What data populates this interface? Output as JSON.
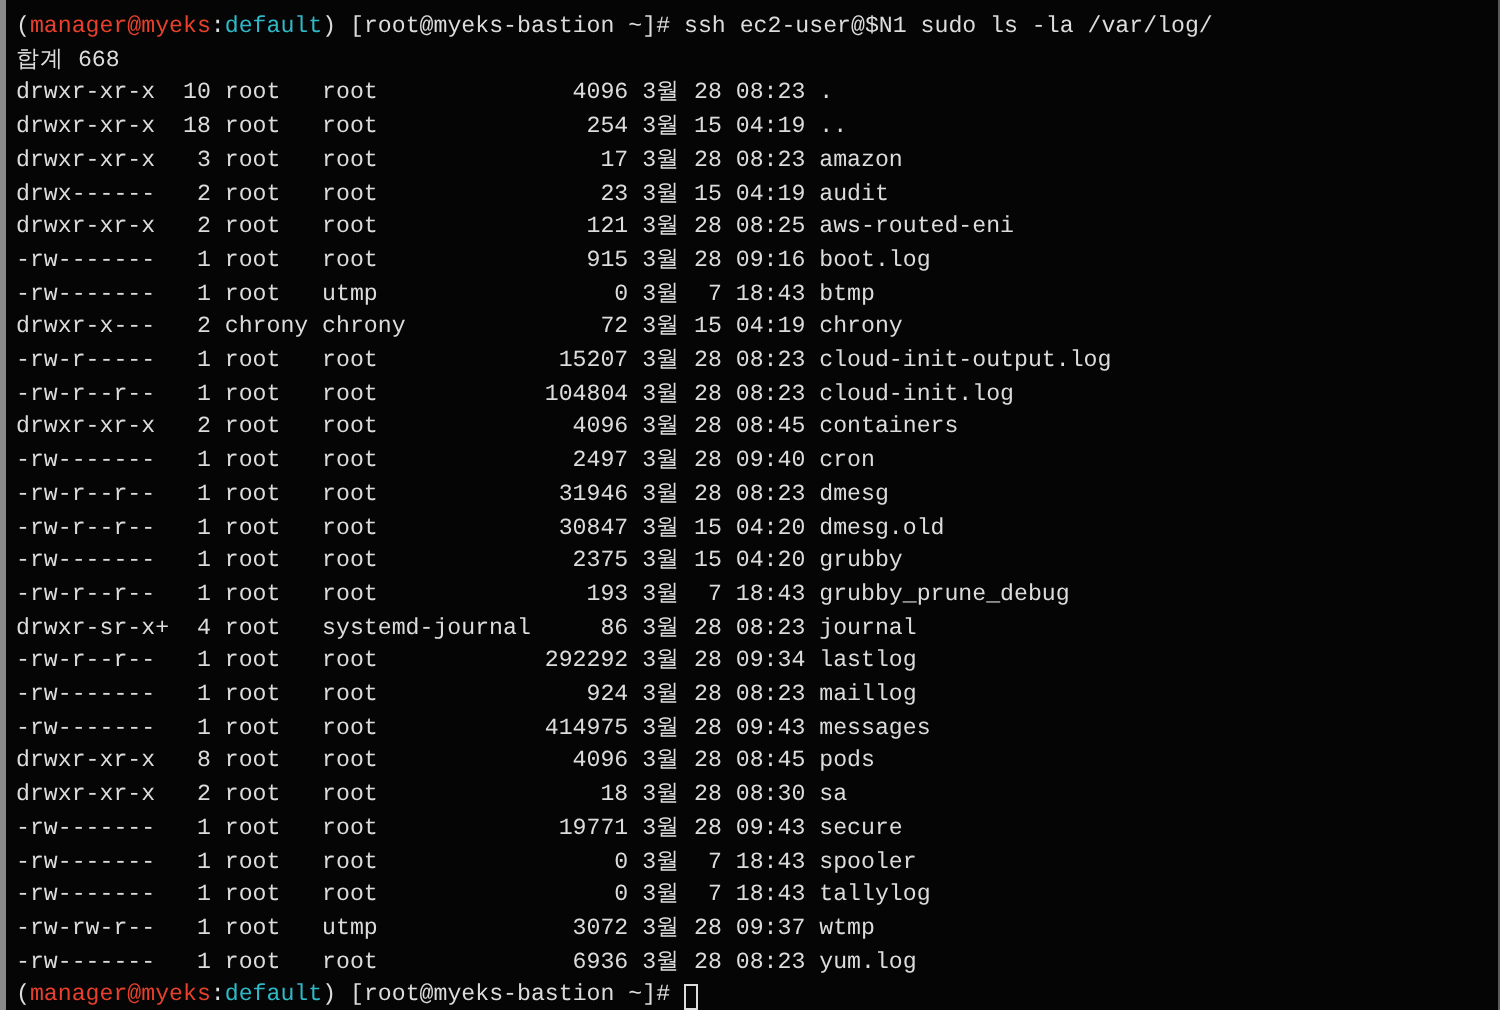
{
  "terminal": {
    "prompt": {
      "segments": [
        {
          "kind": "plain",
          "text": "("
        },
        {
          "kind": "user",
          "text": "manager@myeks"
        },
        {
          "kind": "plain",
          "text": ":"
        },
        {
          "kind": "context",
          "text": "default"
        },
        {
          "kind": "plain",
          "text": ") [root@myeks-bastion ~]# "
        }
      ],
      "command": "ssh ec2-user@$N1 sudo ls -la /var/log/"
    },
    "total": "합계 668",
    "rows": [
      {
        "perms": "drwxr-xr-x",
        "links": "10",
        "owner": "root",
        "group": "root",
        "size": "4096",
        "month": "3월",
        "day": "28",
        "time": "08:23",
        "name": "."
      },
      {
        "perms": "drwxr-xr-x",
        "links": "18",
        "owner": "root",
        "group": "root",
        "size": "254",
        "month": "3월",
        "day": "15",
        "time": "04:19",
        "name": ".."
      },
      {
        "perms": "drwxr-xr-x",
        "links": "3",
        "owner": "root",
        "group": "root",
        "size": "17",
        "month": "3월",
        "day": "28",
        "time": "08:23",
        "name": "amazon"
      },
      {
        "perms": "drwx------",
        "links": "2",
        "owner": "root",
        "group": "root",
        "size": "23",
        "month": "3월",
        "day": "15",
        "time": "04:19",
        "name": "audit"
      },
      {
        "perms": "drwxr-xr-x",
        "links": "2",
        "owner": "root",
        "group": "root",
        "size": "121",
        "month": "3월",
        "day": "28",
        "time": "08:25",
        "name": "aws-routed-eni"
      },
      {
        "perms": "-rw-------",
        "links": "1",
        "owner": "root",
        "group": "root",
        "size": "915",
        "month": "3월",
        "day": "28",
        "time": "09:16",
        "name": "boot.log"
      },
      {
        "perms": "-rw-------",
        "links": "1",
        "owner": "root",
        "group": "utmp",
        "size": "0",
        "month": "3월",
        "day": "7",
        "time": "18:43",
        "name": "btmp"
      },
      {
        "perms": "drwxr-x---",
        "links": "2",
        "owner": "chrony",
        "group": "chrony",
        "size": "72",
        "month": "3월",
        "day": "15",
        "time": "04:19",
        "name": "chrony"
      },
      {
        "perms": "-rw-r-----",
        "links": "1",
        "owner": "root",
        "group": "root",
        "size": "15207",
        "month": "3월",
        "day": "28",
        "time": "08:23",
        "name": "cloud-init-output.log"
      },
      {
        "perms": "-rw-r--r--",
        "links": "1",
        "owner": "root",
        "group": "root",
        "size": "104804",
        "month": "3월",
        "day": "28",
        "time": "08:23",
        "name": "cloud-init.log"
      },
      {
        "perms": "drwxr-xr-x",
        "links": "2",
        "owner": "root",
        "group": "root",
        "size": "4096",
        "month": "3월",
        "day": "28",
        "time": "08:45",
        "name": "containers"
      },
      {
        "perms": "-rw-------",
        "links": "1",
        "owner": "root",
        "group": "root",
        "size": "2497",
        "month": "3월",
        "day": "28",
        "time": "09:40",
        "name": "cron"
      },
      {
        "perms": "-rw-r--r--",
        "links": "1",
        "owner": "root",
        "group": "root",
        "size": "31946",
        "month": "3월",
        "day": "28",
        "time": "08:23",
        "name": "dmesg"
      },
      {
        "perms": "-rw-r--r--",
        "links": "1",
        "owner": "root",
        "group": "root",
        "size": "30847",
        "month": "3월",
        "day": "15",
        "time": "04:20",
        "name": "dmesg.old"
      },
      {
        "perms": "-rw-------",
        "links": "1",
        "owner": "root",
        "group": "root",
        "size": "2375",
        "month": "3월",
        "day": "15",
        "time": "04:20",
        "name": "grubby"
      },
      {
        "perms": "-rw-r--r--",
        "links": "1",
        "owner": "root",
        "group": "root",
        "size": "193",
        "month": "3월",
        "day": "7",
        "time": "18:43",
        "name": "grubby_prune_debug"
      },
      {
        "perms": "drwxr-sr-x+",
        "links": "4",
        "owner": "root",
        "group": "systemd-journal",
        "size": "86",
        "month": "3월",
        "day": "28",
        "time": "08:23",
        "name": "journal"
      },
      {
        "perms": "-rw-r--r--",
        "links": "1",
        "owner": "root",
        "group": "root",
        "size": "292292",
        "month": "3월",
        "day": "28",
        "time": "09:34",
        "name": "lastlog"
      },
      {
        "perms": "-rw-------",
        "links": "1",
        "owner": "root",
        "group": "root",
        "size": "924",
        "month": "3월",
        "day": "28",
        "time": "08:23",
        "name": "maillog"
      },
      {
        "perms": "-rw-------",
        "links": "1",
        "owner": "root",
        "group": "root",
        "size": "414975",
        "month": "3월",
        "day": "28",
        "time": "09:43",
        "name": "messages"
      },
      {
        "perms": "drwxr-xr-x",
        "links": "8",
        "owner": "root",
        "group": "root",
        "size": "4096",
        "month": "3월",
        "day": "28",
        "time": "08:45",
        "name": "pods"
      },
      {
        "perms": "drwxr-xr-x",
        "links": "2",
        "owner": "root",
        "group": "root",
        "size": "18",
        "month": "3월",
        "day": "28",
        "time": "08:30",
        "name": "sa"
      },
      {
        "perms": "-rw-------",
        "links": "1",
        "owner": "root",
        "group": "root",
        "size": "19771",
        "month": "3월",
        "day": "28",
        "time": "09:43",
        "name": "secure"
      },
      {
        "perms": "-rw-------",
        "links": "1",
        "owner": "root",
        "group": "root",
        "size": "0",
        "month": "3월",
        "day": "7",
        "time": "18:43",
        "name": "spooler"
      },
      {
        "perms": "-rw-------",
        "links": "1",
        "owner": "root",
        "group": "root",
        "size": "0",
        "month": "3월",
        "day": "7",
        "time": "18:43",
        "name": "tallylog"
      },
      {
        "perms": "-rw-rw-r--",
        "links": "1",
        "owner": "root",
        "group": "utmp",
        "size": "3072",
        "month": "3월",
        "day": "28",
        "time": "09:37",
        "name": "wtmp"
      },
      {
        "perms": "-rw-------",
        "links": "1",
        "owner": "root",
        "group": "root",
        "size": "6936",
        "month": "3월",
        "day": "28",
        "time": "08:23",
        "name": "yum.log"
      }
    ],
    "next_prompt": {
      "segments": [
        {
          "kind": "plain",
          "text": "("
        },
        {
          "kind": "user",
          "text": "manager@myeks"
        },
        {
          "kind": "plain",
          "text": ":"
        },
        {
          "kind": "context",
          "text": "default"
        },
        {
          "kind": "plain",
          "text": ") [root@myeks-bastion ~]# "
        }
      ],
      "cursor": true
    }
  }
}
